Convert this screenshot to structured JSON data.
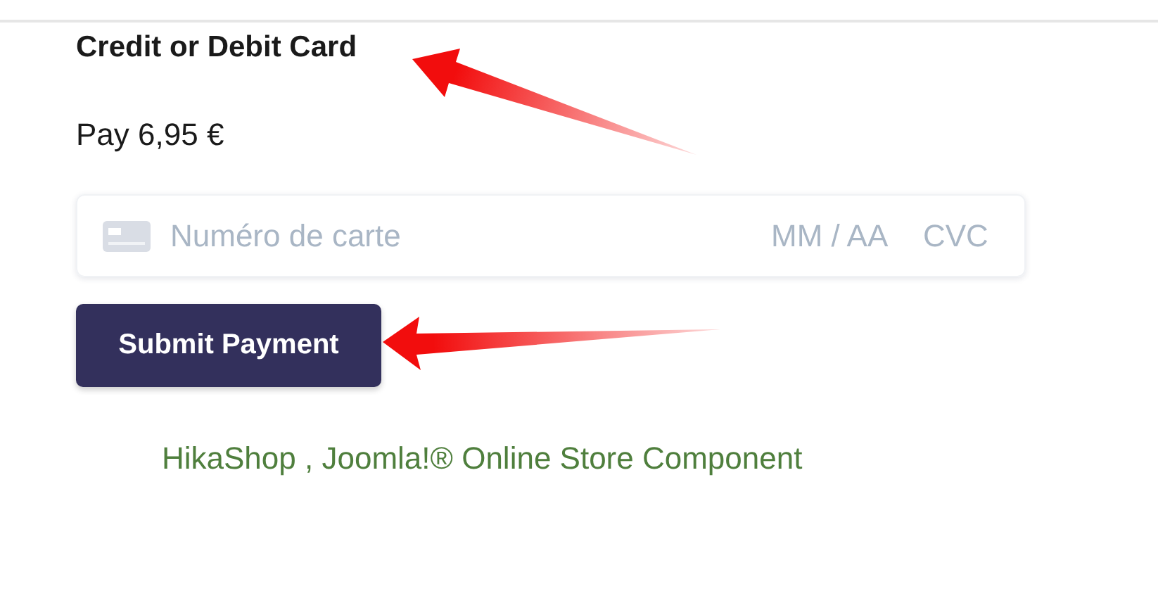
{
  "heading": "Credit or Debit Card",
  "amount": "Pay 6,95 €",
  "card_field": {
    "number_placeholder": "Numéro de carte",
    "expiry_placeholder": "MM / AA",
    "cvc_placeholder": "CVC"
  },
  "submit_button": "Submit Payment",
  "footer_link": "HikaShop , Joomla!® Online Store Component"
}
